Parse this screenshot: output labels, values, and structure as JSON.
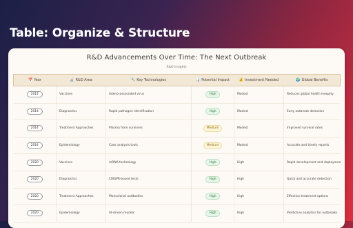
{
  "banner": {
    "title": "Table: Organize & Structure"
  },
  "card": {
    "title": "R&D Advancements Over Time: The Next Outbreak",
    "subtitle": "R&D Insights"
  },
  "table": {
    "headers": [
      {
        "icon": "calendar-icon",
        "glyph": "📅",
        "label": "Year"
      },
      {
        "icon": "area-icon",
        "glyph": "🔬",
        "label": "R&D Area"
      },
      {
        "icon": "technology-icon",
        "glyph": "🔧",
        "label": "Key Technologies"
      },
      {
        "icon": "impact-icon",
        "glyph": "📊",
        "label": "Potential Impact"
      },
      {
        "icon": "investment-icon",
        "glyph": "💰",
        "label": "Investment Needed"
      },
      {
        "icon": "globe-icon",
        "glyph": "🌍",
        "label": "Global Benefits"
      }
    ],
    "rows": [
      {
        "year": "2014",
        "area": "Vaccines",
        "tech": "Adeno-associated virus",
        "impact": "High",
        "impact_level": "high",
        "investment": "Modest",
        "benefit": "Reduces global health inequity"
      },
      {
        "year": "2014",
        "area": "Diagnostics",
        "tech": "Rapid pathogen identification",
        "impact": "High",
        "impact_level": "high",
        "investment": "Modest",
        "benefit": "Early outbreak detection"
      },
      {
        "year": "2014",
        "area": "Treatment Approaches",
        "tech": "Plasma from survivors",
        "impact": "Medium",
        "impact_level": "medium",
        "investment": "Modest",
        "benefit": "Improved survival rates"
      },
      {
        "year": "2014",
        "area": "Epidemiology",
        "tech": "Case analysis tools",
        "impact": "Medium",
        "impact_level": "medium",
        "investment": "Modest",
        "benefit": "Accurate and timely reports"
      },
      {
        "year": "2020",
        "area": "Vaccines",
        "tech": "mRNA technology",
        "impact": "High",
        "impact_level": "high",
        "investment": "High",
        "benefit": "Rapid development and deployment"
      },
      {
        "year": "2020",
        "area": "Diagnostics",
        "tech": "CRISPR-based tests",
        "impact": "High",
        "impact_level": "high",
        "investment": "High",
        "benefit": "Quick and accurate detection"
      },
      {
        "year": "2020",
        "area": "Treatment Approaches",
        "tech": "Monoclonal antibodies",
        "impact": "High",
        "impact_level": "high",
        "investment": "High",
        "benefit": "Effective treatment options"
      },
      {
        "year": "2020",
        "area": "Epidemiology",
        "tech": "AI-driven models",
        "impact": "High",
        "impact_level": "high",
        "investment": "High",
        "benefit": "Predictive analytics for outbreaks"
      }
    ]
  }
}
